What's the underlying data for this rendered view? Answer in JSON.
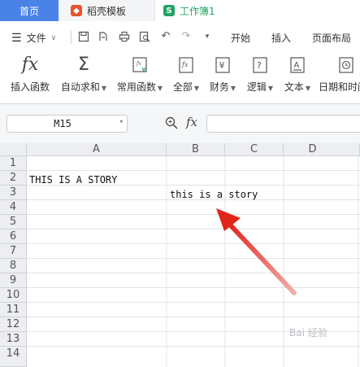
{
  "tabs": {
    "home": "首页",
    "template": "稻壳模板",
    "workbook": "工作簿1",
    "workbook_icon": "S"
  },
  "menu": {
    "file": "文件",
    "items": [
      "开始",
      "插入",
      "页面布局"
    ]
  },
  "ribbon": {
    "buttons": [
      {
        "icon": "fx-insert-function-icon",
        "label": "插入函数"
      },
      {
        "icon": "autosum-icon",
        "label": "自动求和"
      },
      {
        "icon": "common-function-icon",
        "label": "常用函数"
      },
      {
        "icon": "all-functions-icon",
        "label": "全部"
      },
      {
        "icon": "finance-icon",
        "label": "财务"
      },
      {
        "icon": "logic-icon",
        "label": "逻辑"
      },
      {
        "icon": "text-icon",
        "label": "文本"
      },
      {
        "icon": "datetime-icon",
        "label": "日期和时间"
      }
    ]
  },
  "formula_bar": {
    "name_box": "M15",
    "fx_label": "fx",
    "value": ""
  },
  "sheet": {
    "columns": [
      "A",
      "B",
      "C",
      "D"
    ],
    "rows": [
      "1",
      "2",
      "3",
      "4",
      "5",
      "6",
      "7",
      "8",
      "9",
      "10",
      "11",
      "12",
      "13",
      "14"
    ],
    "cells": {
      "A2": "THIS IS A STORY",
      "B3": "this is a story"
    }
  },
  "watermark": "Bai 经验",
  "colors": {
    "home_tab": "#4a83e8",
    "shell_icon": "#e8542c",
    "sheet_green": "#1fa463",
    "arrow": "#e0251b"
  }
}
